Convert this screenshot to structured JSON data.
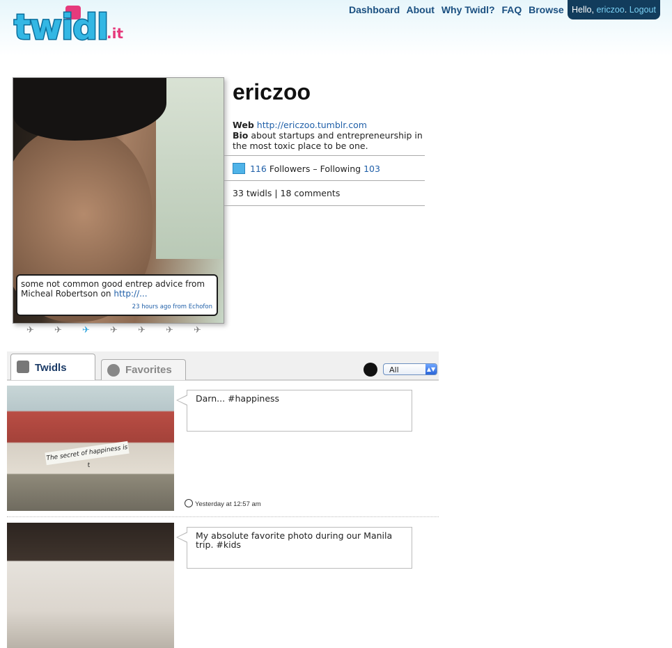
{
  "header": {
    "logo_text": "twidl",
    "logo_suffix": ".it",
    "nav": [
      "Dashboard",
      "About",
      "Why Twidl?",
      "FAQ",
      "Browse"
    ],
    "greeting": "Hello,",
    "username": "ericzoo",
    "separator": ".",
    "logout": "Logout"
  },
  "profile_card": {
    "tweet_text": "some not common good entrep advice from Micheal Robertson on",
    "tweet_link": "http://...",
    "tweet_time": "23 hours ago from",
    "tweet_source": "Echofon"
  },
  "profile": {
    "name": "ericzoo",
    "web_label": "Web",
    "web_url": "http://ericzoo.tumblr.com",
    "bio_label": "Bio",
    "bio": "about startups and entrepreneurship in the most toxic place to be one.",
    "followers_count": "116",
    "followers_text": "Followers – Following",
    "following_count": "103",
    "stats": "33 twidls | 18 comments"
  },
  "tabs": {
    "twidls": "Twidls",
    "favorites": "Favorites",
    "filter_value": "All"
  },
  "posts": [
    {
      "text": "Darn... #happiness",
      "time": "Yesterday at 12:57 am",
      "image_caption": "The secret of happiness is t"
    },
    {
      "text": "My absolute favorite photo during our Manila trip. #kids"
    }
  ],
  "colors": {
    "brand": "#33b7e4",
    "nav": "#1a4f80",
    "userbox": "#123c5c",
    "link": "#1f5fa8"
  }
}
